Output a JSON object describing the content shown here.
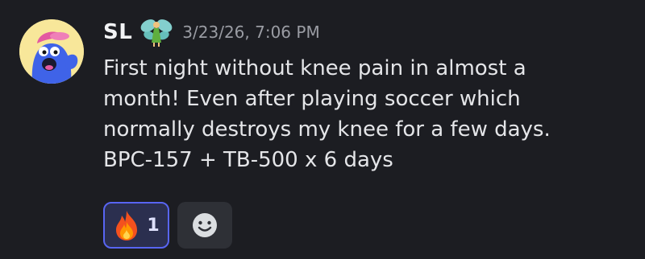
{
  "message": {
    "author": "SL",
    "timestamp": "3/23/26, 7:06 PM",
    "content": "First night without knee pain in almost a\nmonth!  Even after playing soccer which\nnormally destroys my knee for a few days.\nBPC-157 + TB-500 x 6 days",
    "author_badge_icon": "fairy-icon",
    "avatar_icon": "blue-monster-avatar"
  },
  "reactions": [
    {
      "emoji": "fire-icon",
      "count": "1",
      "reacted_by_me": true
    }
  ],
  "add_reaction_icon": "smiley-face-icon",
  "colors": {
    "background": "#1c1d22",
    "reaction_border": "#5865f2",
    "reaction_bg": "#2b2f4f",
    "avatar_bg": "#f8e79a"
  }
}
